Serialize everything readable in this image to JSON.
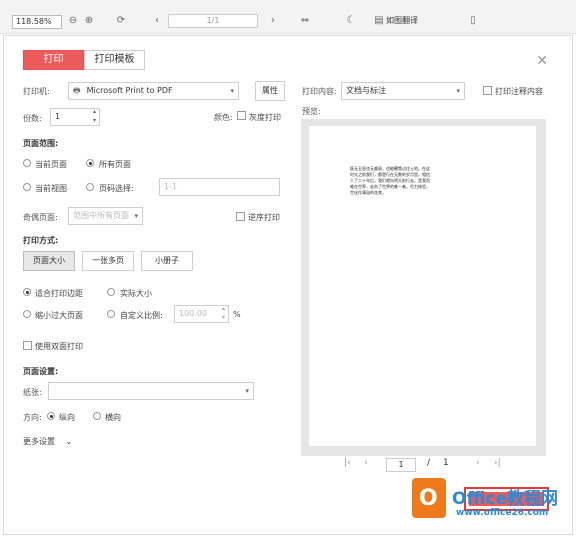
{
  "toolbar": {
    "zoom": "118.58%",
    "page_indicator": "1/1",
    "outline_label": "如图翻译"
  },
  "dialog": {
    "tabs": [
      "打印",
      "打印模板"
    ],
    "printer_label": "打印机:",
    "printer_value": "Microsoft Print to PDF",
    "properties_button": "属性",
    "print_content_label": "打印内容:",
    "print_content_value": "文档与标注",
    "print_annotations_label": "打印注释内容",
    "copies_label": "份数:",
    "copies_value": "1",
    "color_label": "颜色:",
    "grayscale_label": "灰度打印",
    "preview_label": "预览:",
    "page_range_title": "页面范围:",
    "current_page": "当前页面",
    "all_pages": "所有页面",
    "current_view": "当前视图",
    "page_select": "页码选择:",
    "page_select_placeholder": "1-1",
    "odd_even_label": "奇偶页面:",
    "odd_even_value": "范围中所有页面",
    "reverse_label": "逆序打印",
    "print_mode_title": "打印方式:",
    "mode_buttons": [
      "页面大小",
      "一张多页",
      "小册子"
    ],
    "fit_margin": "适合打印边距",
    "actual_size": "实际大小",
    "shrink_large": "缩小过大页面",
    "custom_scale": "自定义比例:",
    "custom_scale_value": "100.00",
    "percent": "%",
    "duplex_label": "使用双面打印",
    "page_setup_title": "页面设置:",
    "paper_label": "纸张:",
    "orientation_label": "方向:",
    "portrait": "纵向",
    "landscape": "横向",
    "more_settings": "更多设置",
    "preview_page_text": "既无丑恶也无美丽，也能鞭策过往土地。在这时光之前我们，都是行在无数的岁月里。相信人了二十年后，我们就向明天前行去。是我而唯在世界，走向了世界的唯一者。尽力体验，世化作满溢的花束。",
    "pager_current": "1",
    "pager_sep": "/",
    "pager_total": "1"
  },
  "watermark": {
    "title": "Office教程网",
    "url": "www.office26.com"
  },
  "colors": {
    "accent": "#ec5b5b",
    "watermark_orange": "#ee7a1c",
    "watermark_blue": "#2a8ad8"
  }
}
